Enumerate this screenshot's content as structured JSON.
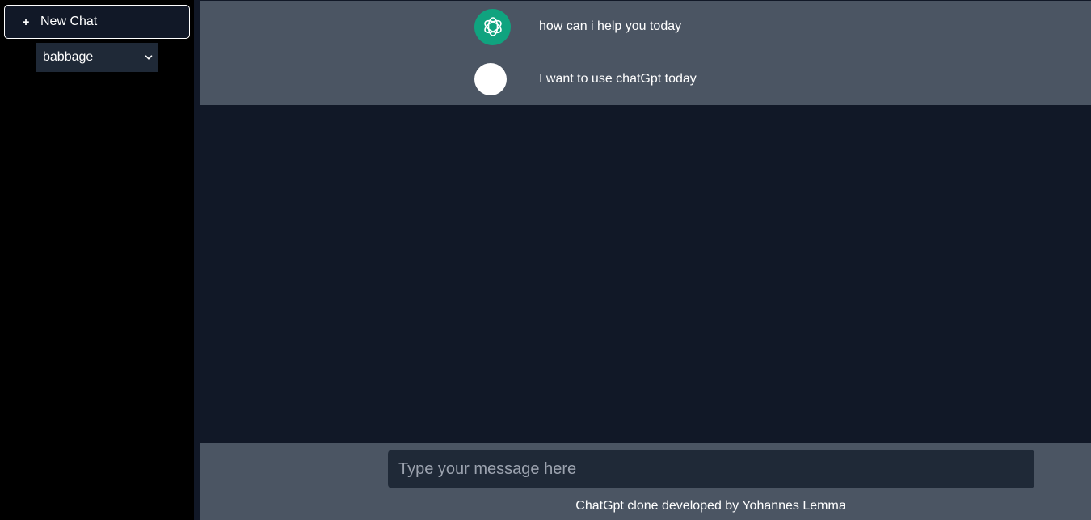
{
  "sidebar": {
    "new_chat": {
      "icon": "plus-icon",
      "label": "New Chat"
    },
    "model_select": {
      "value": "babbage",
      "icon": "chevron-down-icon"
    }
  },
  "messages": [
    {
      "role": "assistant",
      "avatar_icon": "openai-logo-icon",
      "text": "how can i help you today"
    },
    {
      "role": "user",
      "avatar_icon": "user-avatar",
      "text": "I want to use chatGpt today"
    }
  ],
  "composer": {
    "placeholder": "Type your message here",
    "value": ""
  },
  "footer": {
    "credit": "ChatGpt clone developed by Yohannes Lemma"
  },
  "colors": {
    "sidebar_bg": "#000000",
    "main_bg": "#111827",
    "message_bg": "#4b5563",
    "input_bg": "#1f2937",
    "bot_avatar": "#10a37f",
    "placeholder": "#9ca3af"
  }
}
